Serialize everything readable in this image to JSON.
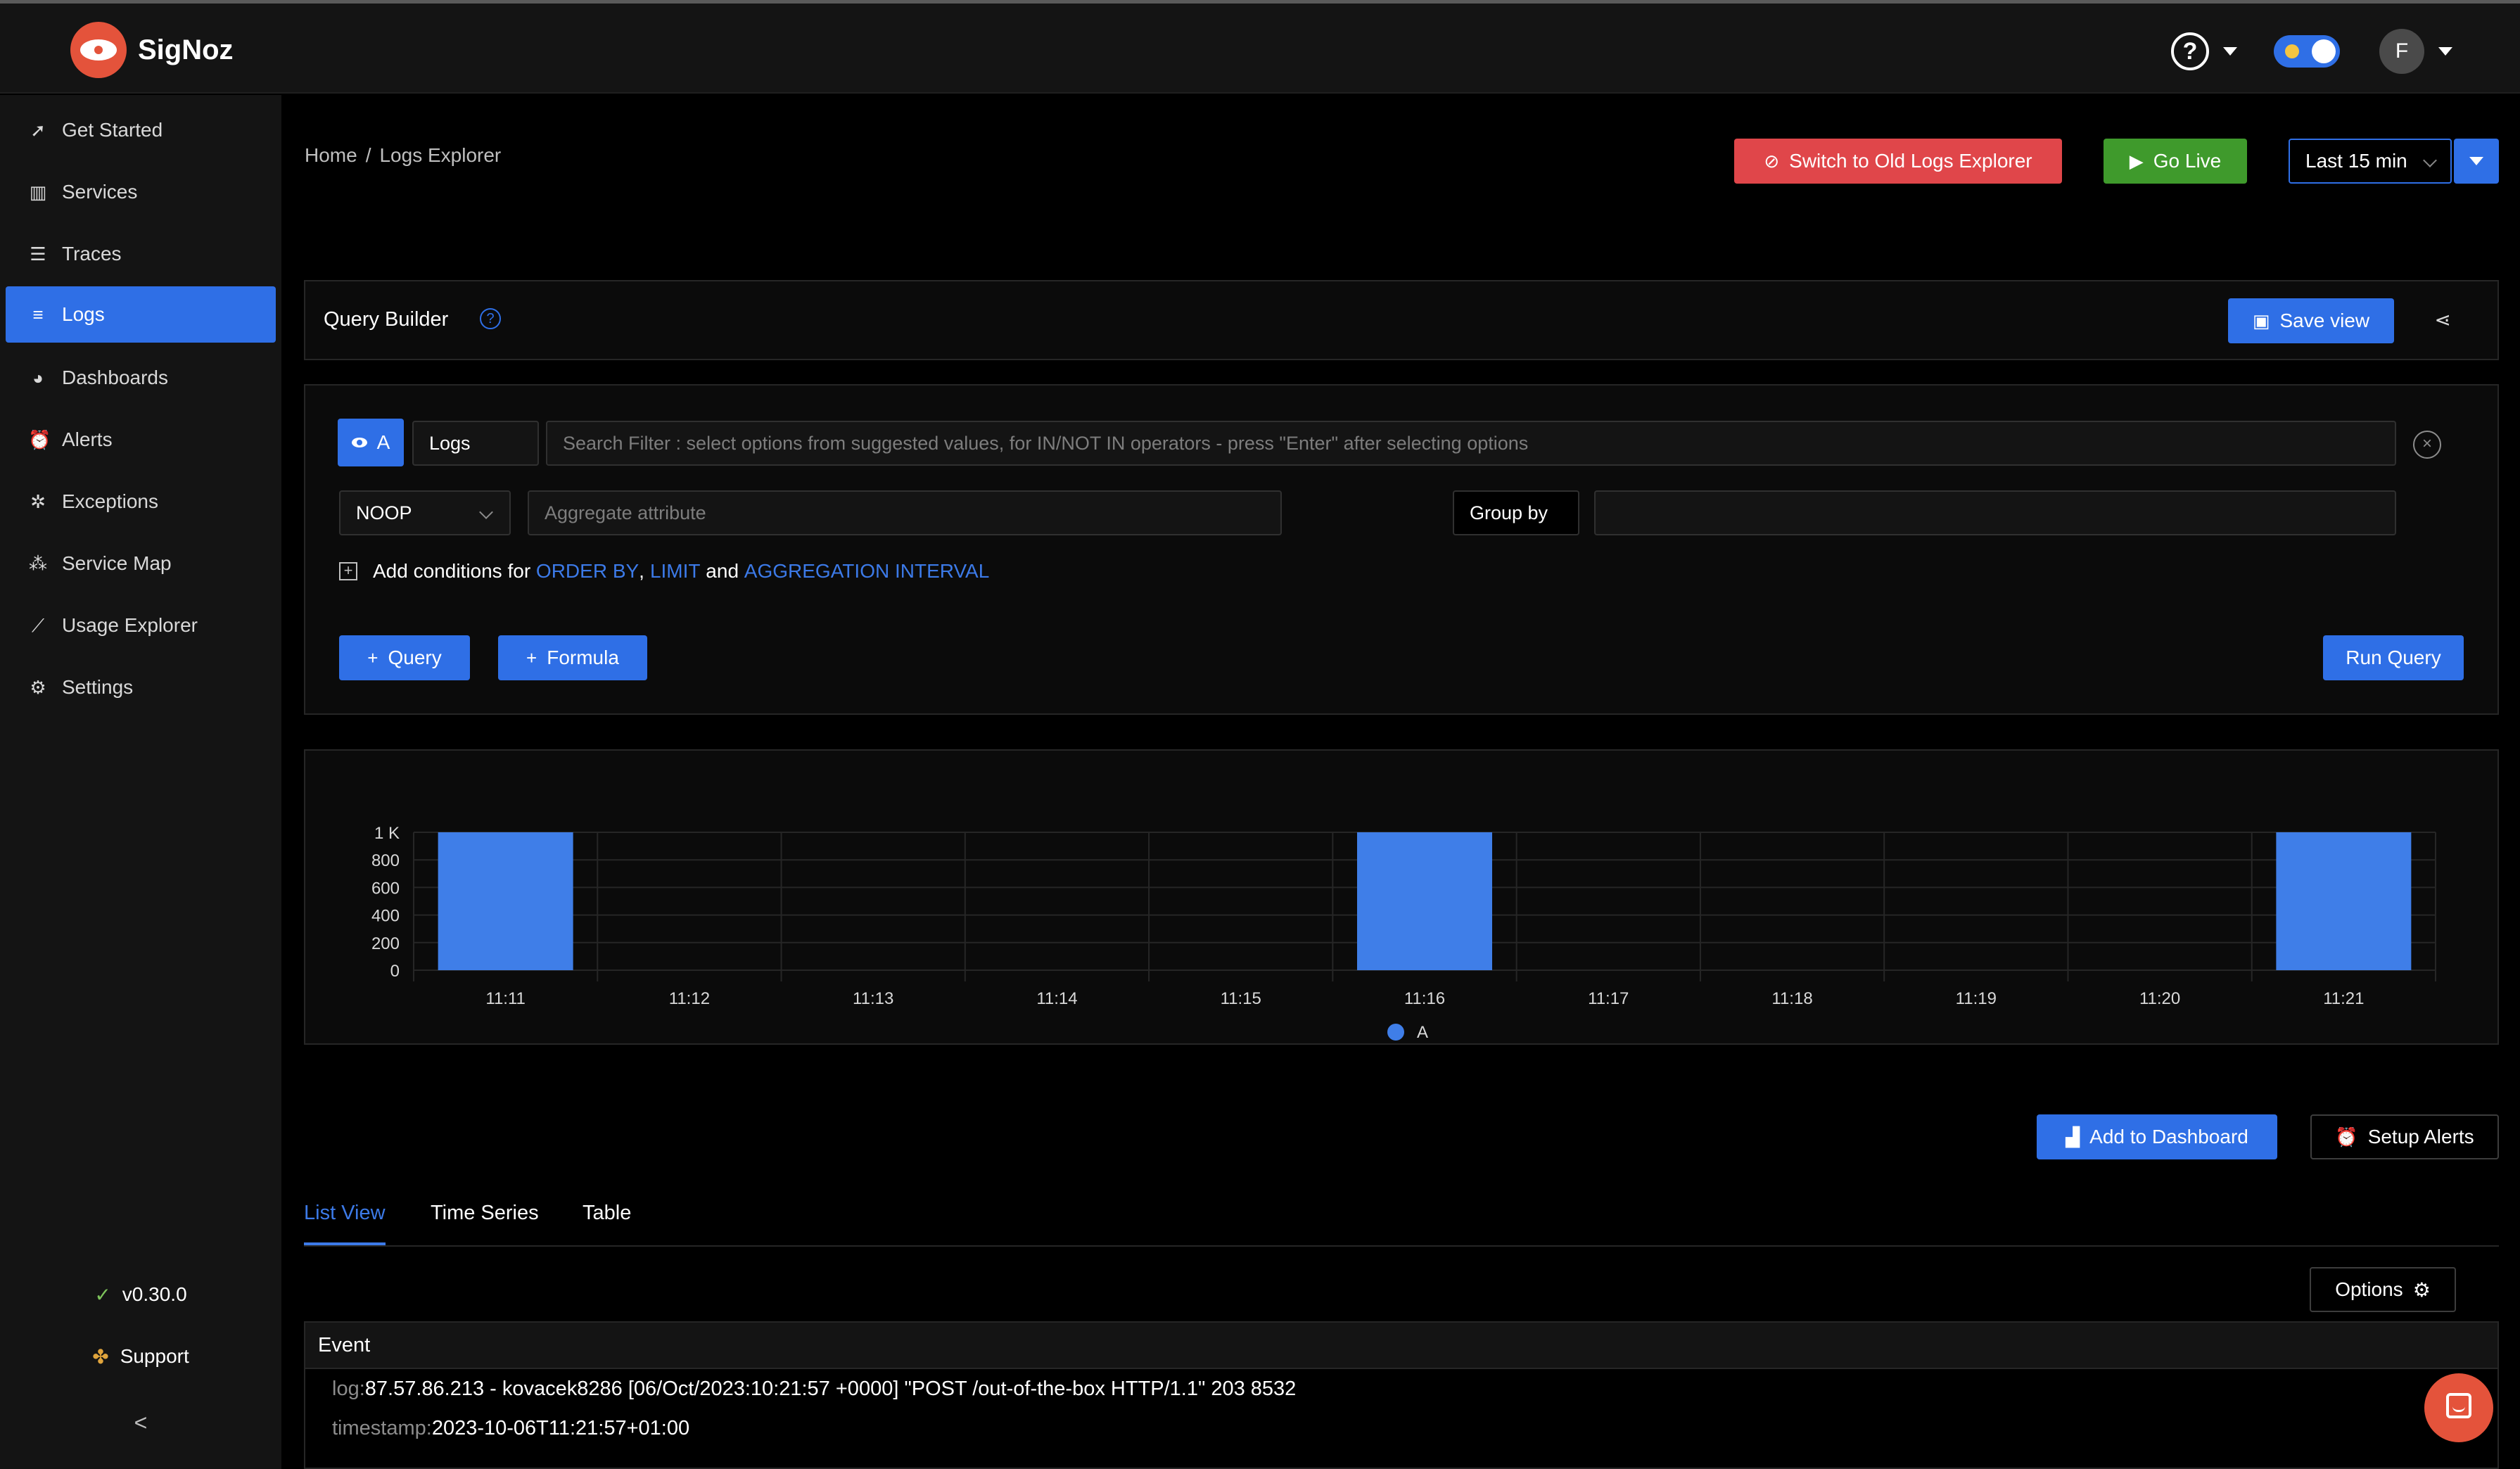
{
  "app": {
    "name": "SigNoz"
  },
  "header": {
    "help_symbol": "?",
    "avatar_initial": "F",
    "icons": [
      "help-circle-icon",
      "theme-toggle",
      "avatar"
    ]
  },
  "sidebar": {
    "items": [
      {
        "label": "Get Started",
        "icon": "rocket-icon"
      },
      {
        "label": "Services",
        "icon": "bar-chart-icon"
      },
      {
        "label": "Traces",
        "icon": "list-icon"
      },
      {
        "label": "Logs",
        "icon": "log-lines-icon",
        "active": true
      },
      {
        "label": "Dashboards",
        "icon": "palette-icon"
      },
      {
        "label": "Alerts",
        "icon": "alarm-icon"
      },
      {
        "label": "Exceptions",
        "icon": "bug-icon"
      },
      {
        "label": "Service Map",
        "icon": "network-icon"
      },
      {
        "label": "Usage Explorer",
        "icon": "line-chart-icon"
      },
      {
        "label": "Settings",
        "icon": "gear-icon"
      }
    ],
    "version": "v0.30.0",
    "support": "Support",
    "collapse_symbol": "<"
  },
  "breadcrumb": {
    "home": "Home",
    "sep": "/",
    "current": "Logs Explorer"
  },
  "toolbar": {
    "switch_old": "Switch to Old Logs Explorer",
    "go_live": "Go Live",
    "time_range": "Last 15 min"
  },
  "query_builder": {
    "title": "Query Builder",
    "help_symbol": "?",
    "save_view": "Save view",
    "query_name": "A",
    "data_source": "Logs",
    "search_placeholder": "Search Filter : select options from suggested values, for IN/NOT IN operators - press \"Enter\" after selecting options",
    "aggregate_operator": "NOOP",
    "aggregate_placeholder": "Aggregate attribute",
    "group_by_label": "Group by",
    "conditions": {
      "prefix": "Add conditions for ",
      "order_by": "ORDER BY",
      "comma": ",",
      "limit": "LIMIT",
      "and": " and ",
      "interval": "AGGREGATION INTERVAL"
    },
    "add_query": "Query",
    "add_formula": "Formula",
    "run_query": "Run Query"
  },
  "chart_data": {
    "type": "bar",
    "x": [
      "11:11",
      "11:12",
      "11:13",
      "11:14",
      "11:15",
      "11:16",
      "11:17",
      "11:18",
      "11:19",
      "11:20",
      "11:21"
    ],
    "y_ticks": [
      "0",
      "200",
      "400",
      "600",
      "800",
      "1 K"
    ],
    "ylim": [
      0,
      1000
    ],
    "series": [
      {
        "name": "A",
        "color": "#3f7ee8",
        "values": [
          1000,
          0,
          0,
          0,
          0,
          1000,
          0,
          0,
          0,
          0,
          1000
        ]
      }
    ],
    "legend": "bottom-center",
    "grid": true
  },
  "actions": {
    "add_dashboard": "Add to Dashboard",
    "setup_alerts": "Setup Alerts"
  },
  "tabs": [
    {
      "label": "List View",
      "active": true
    },
    {
      "label": "Time Series"
    },
    {
      "label": "Table"
    }
  ],
  "list": {
    "options": "Options",
    "column": "Event",
    "rows": [
      {
        "log_key": "log:",
        "log_value": "87.57.86.213 - kovacek8286 [06/Oct/2023:10:21:57 +0000] \"POST /out-of-the-box HTTP/1.1\" 203 8532",
        "ts_key": "timestamp:",
        "ts_value": "2023-10-06T11:21:57+01:00"
      }
    ]
  },
  "colors": {
    "accent": "#2f6fe6",
    "brand": "#e4533b",
    "danger": "#e0464a",
    "success": "#3f9a2c"
  }
}
